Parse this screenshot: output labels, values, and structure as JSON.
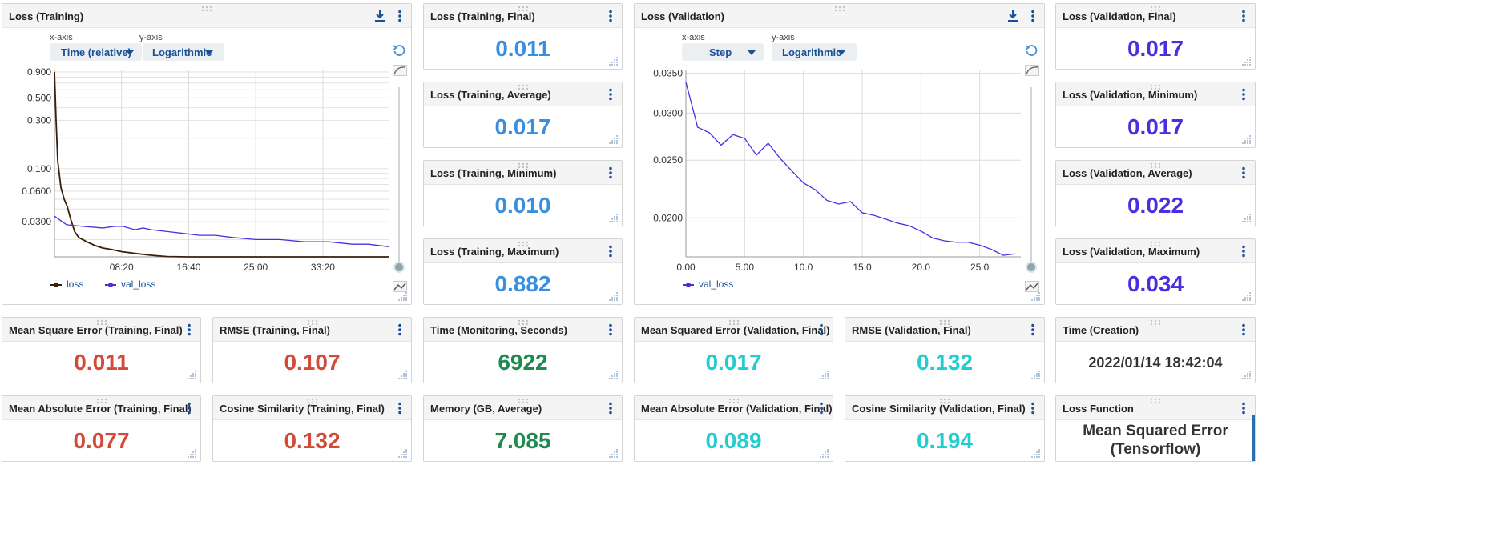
{
  "colors": {
    "train_series": "#3b1f0a",
    "val_series": "#4a2fe0",
    "blue": "#3a8ee0",
    "purple": "#4a2fe0",
    "red": "#d14a3a",
    "green": "#1f8a50",
    "teal": "#22cdd0"
  },
  "icons": {
    "menu": "kebab-menu-icon",
    "download": "download-icon",
    "reset": "reset-zoom-icon",
    "smooth": "smoothing-icon",
    "resize": "resize-handle-icon",
    "drag": "drag-handle-icon"
  },
  "training_chart": {
    "title": "Loss (Training)",
    "xaxis_label": "x-axis",
    "yaxis_label": "y-axis",
    "xaxis_value": "Time (relative)",
    "yaxis_value": "Logarithmic",
    "legend": [
      "loss",
      "val_loss"
    ]
  },
  "validation_chart": {
    "title": "Loss (Validation)",
    "xaxis_label": "x-axis",
    "yaxis_label": "y-axis",
    "xaxis_value": "Step",
    "yaxis_value": "Logarithmic",
    "legend": [
      "val_loss"
    ]
  },
  "chart_data": [
    {
      "type": "line",
      "title": "Loss (Training)",
      "x_axis": "Time (relative)",
      "y_scale": "log",
      "x_tick_labels": [
        "08:20",
        "16:40",
        "25:00",
        "33:20"
      ],
      "y_tick_labels": [
        "0.900",
        "0.500",
        "0.300",
        "0.100",
        "0.0600",
        "0.0300"
      ],
      "x_range_minutes": [
        0,
        41.5
      ],
      "y_range": [
        0.011,
        0.95
      ],
      "grid": true,
      "legend_position": "bottom-left",
      "series": [
        {
          "name": "loss",
          "color": "#3b1f0a",
          "x_minutes": [
            0,
            0.2,
            0.4,
            0.8,
            1.2,
            1.6,
            2,
            2.5,
            3,
            4,
            5,
            6,
            7,
            8.33,
            10,
            12,
            14,
            16.67,
            20,
            23,
            25,
            28,
            31,
            33.33,
            36,
            38,
            40,
            41.5
          ],
          "values": [
            0.9,
            0.3,
            0.12,
            0.065,
            0.05,
            0.042,
            0.032,
            0.024,
            0.021,
            0.019,
            0.0175,
            0.0165,
            0.016,
            0.0152,
            0.0146,
            0.014,
            0.0136,
            0.0132,
            0.0127,
            0.0124,
            0.0122,
            0.0119,
            0.0116,
            0.0114,
            0.0112,
            0.0111,
            0.011,
            0.011
          ]
        },
        {
          "name": "val_loss",
          "color": "#4a2fe0",
          "x_minutes": [
            0,
            1.5,
            3.5,
            6,
            7.5,
            8.5,
            10,
            11,
            12,
            14,
            16,
            18,
            20,
            22,
            25,
            28,
            31,
            34,
            37,
            39,
            41.5
          ],
          "values": [
            0.034,
            0.028,
            0.027,
            0.026,
            0.027,
            0.027,
            0.025,
            0.026,
            0.025,
            0.024,
            0.023,
            0.022,
            0.022,
            0.021,
            0.02,
            0.02,
            0.019,
            0.019,
            0.018,
            0.018,
            0.017
          ]
        }
      ]
    },
    {
      "type": "line",
      "title": "Loss (Validation)",
      "x_axis": "Step",
      "y_scale": "log",
      "x_tick_labels": [
        "0.00",
        "5.00",
        "10.0",
        "15.0",
        "20.0",
        "25.0"
      ],
      "y_tick_labels": [
        "0.0350",
        "0.0300",
        "0.0250",
        "0.0200"
      ],
      "x_range": [
        0,
        28.5
      ],
      "y_range": [
        0.0172,
        0.0355
      ],
      "grid": true,
      "legend_position": "bottom-left",
      "series": [
        {
          "name": "val_loss",
          "color": "#4a2fe0",
          "x": [
            0,
            1,
            2,
            3,
            4,
            5,
            6,
            7,
            8,
            9,
            10,
            11,
            12,
            13,
            14,
            15,
            16,
            17,
            18,
            19,
            20,
            21,
            22,
            23,
            24,
            25,
            26,
            27,
            28
          ],
          "values": [
            0.0338,
            0.0284,
            0.0278,
            0.0265,
            0.0276,
            0.0272,
            0.0255,
            0.0267,
            0.0252,
            0.024,
            0.0229,
            0.0223,
            0.0214,
            0.0211,
            0.0213,
            0.0204,
            0.0202,
            0.0199,
            0.0196,
            0.0194,
            0.019,
            0.0185,
            0.0183,
            0.0182,
            0.0182,
            0.018,
            0.0177,
            0.0173,
            0.0174
          ]
        }
      ]
    }
  ],
  "cards": {
    "train_final": {
      "title": "Loss (Training, Final)",
      "value": "0.011"
    },
    "train_average": {
      "title": "Loss (Training, Average)",
      "value": "0.017"
    },
    "train_minimum": {
      "title": "Loss (Training, Minimum)",
      "value": "0.010"
    },
    "train_maximum": {
      "title": "Loss (Training, Maximum)",
      "value": "0.882"
    },
    "val_final": {
      "title": "Loss (Validation, Final)",
      "value": "0.017"
    },
    "val_minimum": {
      "title": "Loss (Validation, Minimum)",
      "value": "0.017"
    },
    "val_average": {
      "title": "Loss (Validation, Average)",
      "value": "0.022"
    },
    "val_maximum": {
      "title": "Loss (Validation, Maximum)",
      "value": "0.034"
    },
    "mse_train": {
      "title": "Mean Square Error (Training, Final)",
      "value": "0.011"
    },
    "rmse_train": {
      "title": "RMSE (Training, Final)",
      "value": "0.107"
    },
    "time_monitoring": {
      "title": "Time (Monitoring, Seconds)",
      "value": "6922"
    },
    "mse_val": {
      "title": "Mean Squared Error (Validation, Final)",
      "value": "0.017"
    },
    "rmse_val": {
      "title": "RMSE (Validation, Final)",
      "value": "0.132"
    },
    "time_creation": {
      "title": "Time (Creation)",
      "value": "2022/01/14 18:42:04"
    },
    "mae_train": {
      "title": "Mean Absolute Error (Training, Final)",
      "value": "0.077"
    },
    "cos_train": {
      "title": "Cosine Similarity (Training, Final)",
      "value": "0.132"
    },
    "memory": {
      "title": "Memory (GB, Average)",
      "value": "7.085"
    },
    "mae_val": {
      "title": "Mean Absolute Error (Validation, Final)",
      "value": "0.089"
    },
    "cos_val": {
      "title": "Cosine Similarity (Validation, Final)",
      "value": "0.194"
    },
    "loss_function": {
      "title": "Loss Function",
      "value_line1": "Mean Squared Error",
      "value_line2": "(Tensorflow)"
    }
  }
}
